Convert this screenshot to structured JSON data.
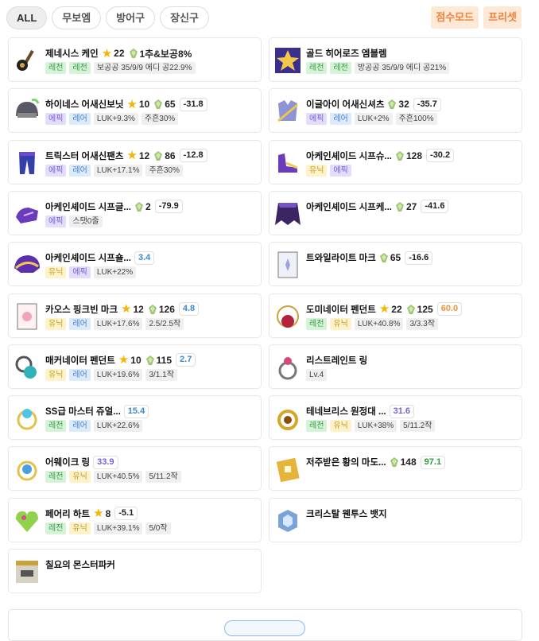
{
  "filters": [
    "ALL",
    "무보엠",
    "방어구",
    "장신구"
  ],
  "right_buttons": [
    "점수모드",
    "프리셋"
  ],
  "gem_icon": "soul-gem-icon",
  "star_icon": "star-icon",
  "items": [
    {
      "name": "제네시스 케인",
      "icon": "cane-icon",
      "star": "22",
      "gem": "1추&보공8%",
      "tags": [
        [
          "레전",
          "legend"
        ],
        [
          "레전",
          "legend"
        ],
        [
          "보공공 35/9/9 에디 공22.9%",
          "plain"
        ]
      ]
    },
    {
      "name": "골드 히어로즈 엠블렘",
      "icon": "emblem-icon",
      "tags": [
        [
          "레전",
          "legend"
        ],
        [
          "레전",
          "legend"
        ],
        [
          "방공공 35/9/9 에디 공21%",
          "plain"
        ]
      ]
    },
    {
      "name": "하이네스 어새신보닛",
      "icon": "helmet-icon",
      "star": "10",
      "gem": "65",
      "pill": "-31.8",
      "pc": "plain",
      "tags": [
        [
          "에픽",
          "epic"
        ],
        [
          "레어",
          "rare"
        ],
        [
          "LUK+9.3%",
          "plain"
        ],
        [
          "주흔30%",
          "plain"
        ]
      ]
    },
    {
      "name": "이글아이 어새신셔츠",
      "icon": "top-armor-icon",
      "gem": "32",
      "pill": "-35.7",
      "pc": "plain",
      "tags": [
        [
          "에픽",
          "epic"
        ],
        [
          "레어",
          "rare"
        ],
        [
          "LUK+2%",
          "plain"
        ],
        [
          "주흔100%",
          "plain"
        ]
      ]
    },
    {
      "name": "트릭스터 어새신팬츠",
      "icon": "pants-icon",
      "star": "12",
      "gem": "86",
      "pill": "-12.8",
      "pc": "plain",
      "tags": [
        [
          "에픽",
          "epic"
        ],
        [
          "레어",
          "rare"
        ],
        [
          "LUK+17.1%",
          "plain"
        ],
        [
          "주흔30%",
          "plain"
        ]
      ]
    },
    {
      "name": "아케인셰이드 시프슈...",
      "icon": "shoes-icon",
      "gem": "128",
      "pill": "-30.2",
      "pc": "plain",
      "tags": [
        [
          "유닉",
          "unique"
        ],
        [
          "에픽",
          "epic"
        ]
      ]
    },
    {
      "name": "아케인셰이드 시프글...",
      "icon": "glove-icon",
      "gem": "2",
      "pill": "-79.9",
      "pc": "plain",
      "tags": [
        [
          "에픽",
          "epic"
        ],
        [
          "스탯0줄",
          "plain"
        ]
      ]
    },
    {
      "name": "아케인셰이드 시프케...",
      "icon": "cape-icon",
      "gem": "27",
      "pill": "-41.6",
      "pc": "plain",
      "tags": []
    },
    {
      "name": "아케인셰이드 시프숄...",
      "icon": "shoulder-icon",
      "pill": "3.4",
      "pc": "blue",
      "tags": [
        [
          "유닉",
          "unique"
        ],
        [
          "에픽",
          "epic"
        ],
        [
          "LUK+22%",
          "plain"
        ]
      ]
    },
    {
      "name": "트와일라이트 마크",
      "icon": "mark-icon",
      "gem": "65",
      "pill": "-16.6",
      "pc": "plain",
      "tags": []
    },
    {
      "name": "카오스 핑크빈 마크",
      "icon": "pinkbean-mark-icon",
      "star": "12",
      "gem": "126",
      "pill": "4.8",
      "pc": "blue",
      "tags": [
        [
          "유닉",
          "unique"
        ],
        [
          "레어",
          "rare"
        ],
        [
          "LUK+17.6%",
          "plain"
        ],
        [
          "2.5/2.5작",
          "plain"
        ]
      ]
    },
    {
      "name": "도미네이터 펜던트",
      "icon": "pendant-icon",
      "star": "22",
      "gem": "125",
      "pill": "60.0",
      "pc": "orange",
      "tags": [
        [
          "레전",
          "legend"
        ],
        [
          "유닉",
          "unique"
        ],
        [
          "LUK+40.8%",
          "plain"
        ],
        [
          "3/3.3작",
          "plain"
        ]
      ]
    },
    {
      "name": "매커네이터 펜던트",
      "icon": "mech-pendant-icon",
      "star": "10",
      "gem": "115",
      "pill": "2.7",
      "pc": "blue",
      "tags": [
        [
          "유닉",
          "unique"
        ],
        [
          "레어",
          "rare"
        ],
        [
          "LUK+19.6%",
          "plain"
        ],
        [
          "3/1.1작",
          "plain"
        ]
      ]
    },
    {
      "name": "리스트레인트 링",
      "icon": "ring-icon",
      "tags": [
        [
          "Lv.4",
          "plain"
        ]
      ]
    },
    {
      "name": "SS급 마스터 쥬얼...",
      "icon": "jewel-ring-icon",
      "pill": "15.4",
      "pc": "blue",
      "tags": [
        [
          "레전",
          "legend"
        ],
        [
          "레어",
          "rare"
        ],
        [
          "LUK+22.6%",
          "plain"
        ]
      ]
    },
    {
      "name": "테네브리스 원정대 ...",
      "icon": "tenebris-ring-icon",
      "pill": "31.6",
      "pc": "purple",
      "tags": [
        [
          "레전",
          "legend"
        ],
        [
          "유닉",
          "unique"
        ],
        [
          "LUK+38%",
          "plain"
        ],
        [
          "5/11.2작",
          "plain"
        ]
      ]
    },
    {
      "name": "어웨이크 링",
      "icon": "awake-ring-icon",
      "pill": "33.9",
      "pc": "purple",
      "tags": [
        [
          "레전",
          "legend"
        ],
        [
          "유닉",
          "unique"
        ],
        [
          "LUK+40.5%",
          "plain"
        ],
        [
          "5/11.2작",
          "plain"
        ]
      ]
    },
    {
      "name": "저주받은 황의 마도...",
      "icon": "grimoire-icon",
      "gem": "148",
      "pill": "97.1",
      "pc": "green",
      "tags": []
    },
    {
      "name": "페어리 하트",
      "icon": "heart-icon",
      "star": "8",
      "pill": "-5.1",
      "pc": "plain",
      "tags": [
        [
          "레전",
          "legend"
        ],
        [
          "유닉",
          "unique"
        ],
        [
          "LUK+39.1%",
          "plain"
        ],
        [
          "5/0작",
          "plain"
        ]
      ]
    },
    {
      "name": "크리스탈 웬투스 뱃지",
      "icon": "badge-icon",
      "tags": []
    },
    {
      "name": "칠요의 몬스터파커",
      "icon": "monsterpark-icon",
      "tags": []
    }
  ]
}
